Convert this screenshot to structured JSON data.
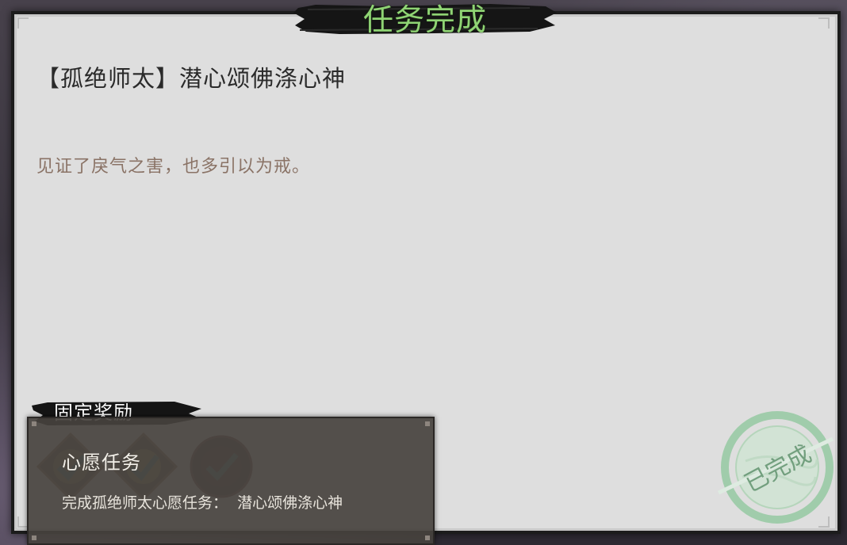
{
  "header": {
    "title": "任务完成"
  },
  "quest": {
    "title": "【孤绝师太】潜心颂佛涤心神",
    "description": "见证了戾气之害，也多引以为戒。"
  },
  "rewards": {
    "label": "固定奖励",
    "items": [
      {
        "icon": "reward-item-icon",
        "status": "checked"
      },
      {
        "icon": "reward-item-icon",
        "status": "checked"
      },
      {
        "icon": "reward-item-icon",
        "status": "checked"
      }
    ]
  },
  "tooltip": {
    "title": "心愿任务",
    "desc_prefix": "完成孤绝师太心愿任务：",
    "desc_value": "潜心颂佛涤心神"
  },
  "stamp": {
    "text": "已完成"
  },
  "colors": {
    "title_green": "#8fd474",
    "paper": "#dedede",
    "desc_brown": "#8a7366",
    "stamp_green": "#6aa87a"
  }
}
